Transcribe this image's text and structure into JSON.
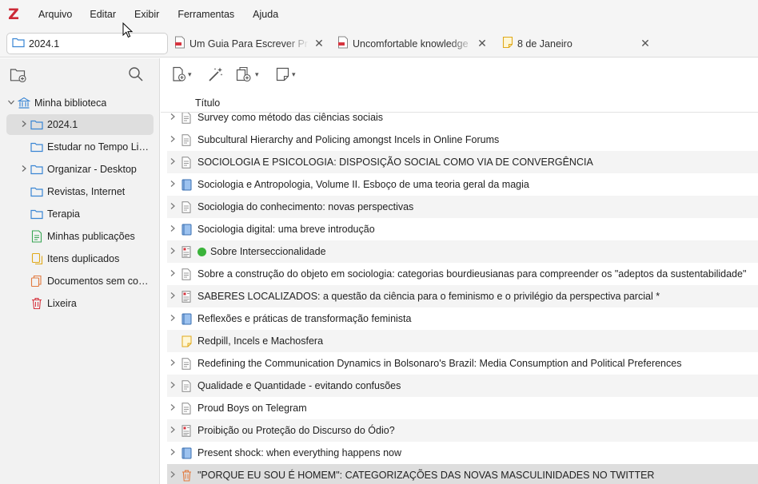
{
  "app": {
    "logo_letter": "Z",
    "accent_color": "#cc2936"
  },
  "menu": [
    "Arquivo",
    "Editar",
    "Exibir",
    "Ferramentas",
    "Ajuda"
  ],
  "tabs": {
    "library_tab": {
      "label": "2024.1",
      "icon": "folder-icon"
    },
    "reader_tabs": [
      {
        "label": "Um Guia Para Escrever Pr",
        "icon": "pdf-icon"
      },
      {
        "label": "Uncomfortable knowledge",
        "icon": "pdf-icon"
      },
      {
        "label": "8 de Janeiro",
        "icon": "note-icon"
      }
    ]
  },
  "left_toolbar": {
    "new_collection_icon": "new-collection-icon",
    "search_icon": "search-icon"
  },
  "tree": {
    "library": {
      "label": "Minha biblioteca",
      "icon": "library-icon"
    },
    "items": [
      {
        "label": "2024.1",
        "icon": "folder-icon",
        "expandable": true,
        "selected": true
      },
      {
        "label": "Estudar no Tempo Livre",
        "icon": "folder-icon",
        "expandable": false
      },
      {
        "label": "Organizar - Desktop",
        "icon": "folder-icon",
        "expandable": true
      },
      {
        "label": "Revistas, Internet",
        "icon": "folder-icon",
        "expandable": false
      },
      {
        "label": "Terapia",
        "icon": "folder-icon",
        "expandable": false
      },
      {
        "label": "Minhas publicações",
        "icon": "publications-icon",
        "expandable": false
      },
      {
        "label": "Itens duplicados",
        "icon": "duplicates-icon",
        "expandable": false
      },
      {
        "label": "Documentos sem coleção",
        "icon": "unfiled-icon",
        "expandable": false
      },
      {
        "label": "Lixeira",
        "icon": "trash-icon",
        "expandable": false
      }
    ]
  },
  "right_toolbar": {
    "new_item_icon": "new-item-icon",
    "magic_wand_icon": "add-by-identifier-icon",
    "add_attachment_icon": "add-attachment-icon",
    "new_note_icon": "new-note-icon"
  },
  "items_header": {
    "title": "Título"
  },
  "items": [
    {
      "title": "Survey como método das ciências sociais",
      "icon": "document-icon",
      "expandable": true
    },
    {
      "title": "Subcultural Hierarchy and Policing amongst Incels in Online Forums",
      "icon": "document-icon",
      "expandable": true
    },
    {
      "title": "SOCIOLOGIA E PSICOLOGIA: DISPOSIÇÃO SOCIAL COMO VIA DE CONVERGÊNCIA",
      "icon": "document-icon",
      "expandable": true
    },
    {
      "title": "Sociologia e Antropologia, Volume II. Esboço de uma teoria geral da magia",
      "icon": "book-icon",
      "expandable": true
    },
    {
      "title": "Sociologia do conhecimento: novas perspectivas",
      "icon": "document-icon",
      "expandable": true
    },
    {
      "title": "Sociologia digital: uma breve introdução",
      "icon": "book-icon",
      "expandable": true
    },
    {
      "title": "Sobre Interseccionalidade",
      "icon": "journal-article-icon",
      "expandable": true,
      "dot": true
    },
    {
      "title": "Sobre a construção do objeto em sociologia: categorias bourdieusianas para compreender os \"adeptos da sustentabilidade\"",
      "icon": "document-icon",
      "expandable": true
    },
    {
      "title": "SABERES LOCALIZADOS: a questão da ciência para o feminismo e o privilégio da perspectiva parcial *",
      "icon": "journal-article-icon",
      "expandable": true
    },
    {
      "title": "Reflexões e práticas de transformação feminista",
      "icon": "book-icon",
      "expandable": true
    },
    {
      "title": "Redpill, Incels e Machosfera",
      "icon": "note-icon",
      "expandable": false
    },
    {
      "title": "Redefining the Communication Dynamics in Bolsonaro's Brazil: Media Consumption and Political Preferences",
      "icon": "document-icon",
      "expandable": true
    },
    {
      "title": "Qualidade e Quantidade - evitando confusões",
      "icon": "document-icon",
      "expandable": true
    },
    {
      "title": "Proud Boys on Telegram",
      "icon": "document-icon",
      "expandable": true
    },
    {
      "title": "Proibição ou Proteção do Discurso do Ódio?",
      "icon": "journal-article-icon",
      "expandable": true
    },
    {
      "title": "Present shock: when everything happens now",
      "icon": "book-icon",
      "expandable": true
    },
    {
      "title": "\"PORQUE EU SOU É HOMEM\": CATEGORIZAÇÕES DAS NOVAS MASCULINIDADES NO TWITTER",
      "icon": "trash-item-icon",
      "expandable": true,
      "selected": true
    }
  ]
}
